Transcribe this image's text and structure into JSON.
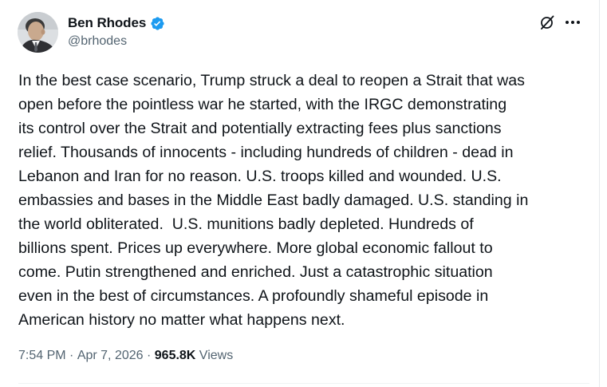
{
  "tweet": {
    "author": {
      "display_name": "Ben Rhodes",
      "handle": "@brhodes",
      "verified": true,
      "avatar_icon": "profile-photo"
    },
    "text_lines": [
      "In the best case scenario, Trump struck a deal to reopen a Strait that was",
      "open before the pointless war he started, with the IRGC demonstrating",
      "its control over the Strait and potentially extracting fees plus sanctions",
      "relief. Thousands of innocents - including hundreds of children - dead in",
      "Lebanon and Iran for no reason. U.S. troops killed and wounded. U.S.",
      "embassies and bases in the Middle East badly damaged. U.S. standing in",
      "the world obliterated.  U.S. munitions badly depleted. Hundreds of",
      "billions spent. Prices up everywhere. More global economic fallout to",
      "come. Putin strengthened and enriched. Just a catastrophic situation",
      "even in the best of circumstances. A profoundly shameful episode in",
      "American history no matter what happens next."
    ],
    "time": "7:54 PM",
    "date": "Apr 7, 2026",
    "separator": " · ",
    "views_count": "965.8K",
    "views_label": " Views"
  },
  "icons": {
    "verified": "verified-badge-icon",
    "grok": "grok-icon",
    "more": "more-options-icon"
  },
  "colors": {
    "verified_blue": "#1d9bf0",
    "text_primary": "#0f1419",
    "text_secondary": "#536471"
  }
}
